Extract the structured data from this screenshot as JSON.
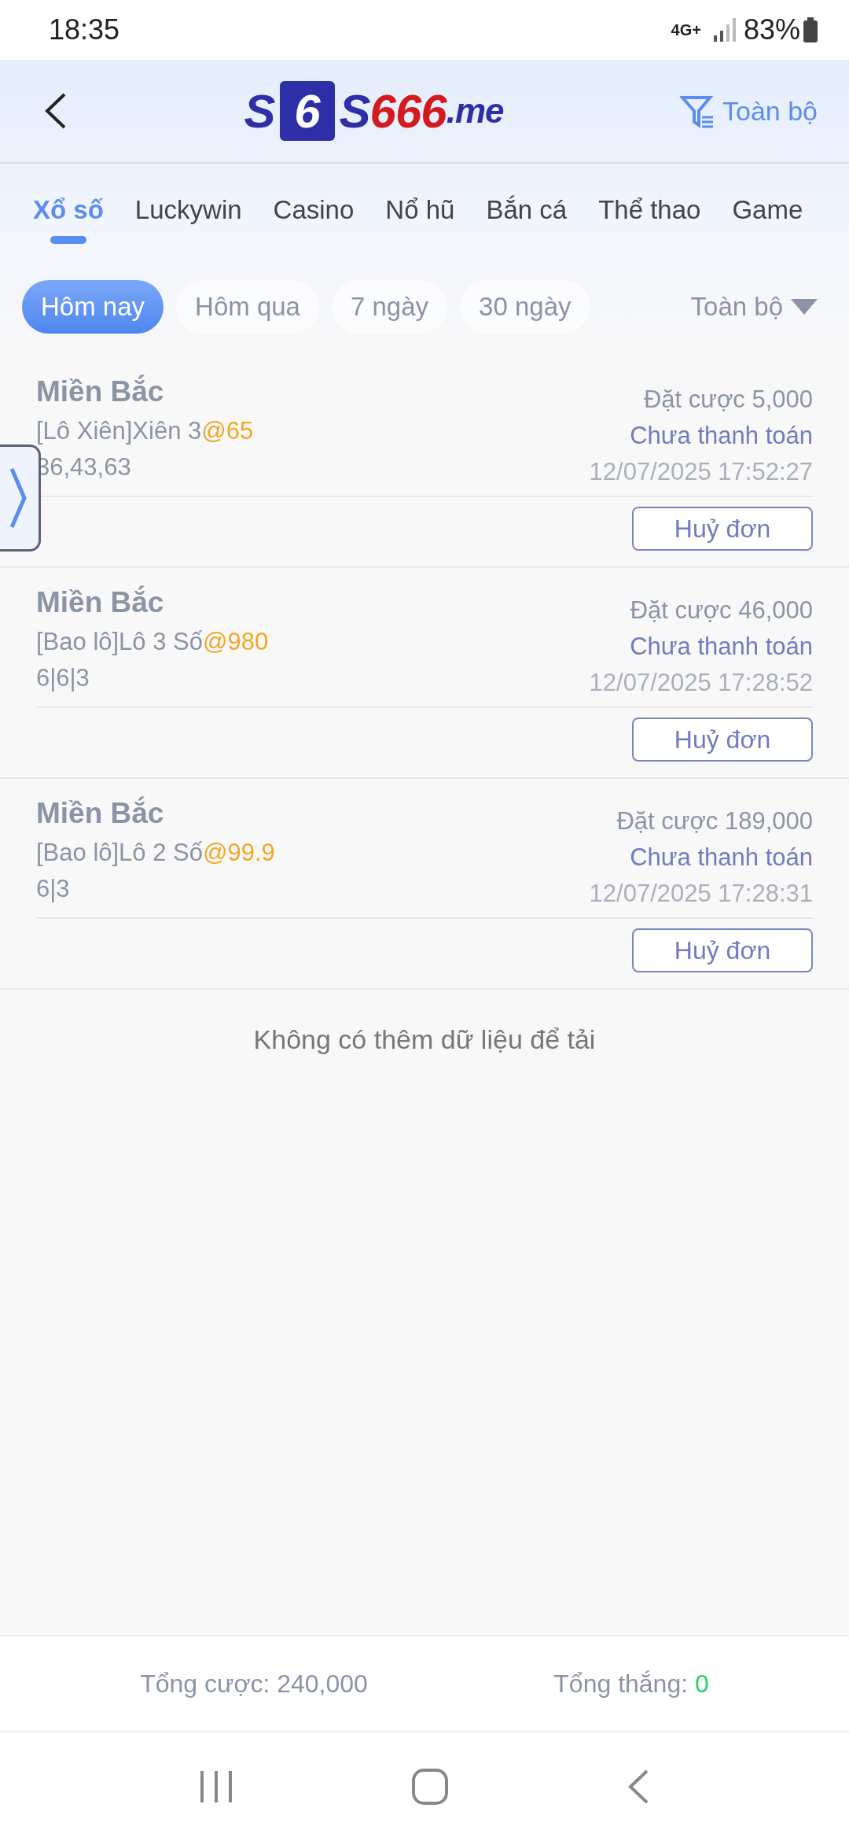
{
  "status_bar": {
    "time": "18:35",
    "network": "4G+",
    "battery": "83%"
  },
  "header": {
    "logo": {
      "left": "S",
      "dice": "6",
      "brand": "S",
      "digits": "666",
      "suffix": ".me"
    },
    "filter": "Toàn bộ"
  },
  "tabs": [
    {
      "label": "Xổ số",
      "selected": true
    },
    {
      "label": "Luckywin",
      "selected": false
    },
    {
      "label": "Casino",
      "selected": false
    },
    {
      "label": "Nổ hũ",
      "selected": false
    },
    {
      "label": "Bắn cá",
      "selected": false
    },
    {
      "label": "Thể thao",
      "selected": false
    },
    {
      "label": "Game",
      "selected": false
    }
  ],
  "periods": [
    {
      "label": "Hôm nay",
      "selected": true
    },
    {
      "label": "Hôm qua",
      "selected": false
    },
    {
      "label": "7 ngày",
      "selected": false
    },
    {
      "label": "30 ngày",
      "selected": false
    }
  ],
  "status_filter": "Toàn bộ",
  "bets": [
    {
      "region": "Miền Bắc",
      "bet_type": "[Lô Xiên]Xiên 3",
      "odds": "@65",
      "numbers": "36,43,63",
      "amount": "Đặt cược 5,000",
      "status": "Chưa thanh toán",
      "time": "12/07/2025 17:52:27",
      "action": "Huỷ đơn"
    },
    {
      "region": "Miền Bắc",
      "bet_type": "[Bao lô]Lô 3 Số",
      "odds": "@980",
      "numbers": "6|6|3",
      "amount": "Đặt cược 46,000",
      "status": "Chưa thanh toán",
      "time": "12/07/2025 17:28:52",
      "action": "Huỷ đơn"
    },
    {
      "region": "Miền Bắc",
      "bet_type": "[Bao lô]Lô 2 Số",
      "odds": "@99.9",
      "numbers": "6|3",
      "amount": "Đặt cược 189,000",
      "status": "Chưa thanh toán",
      "time": "12/07/2025 17:28:31",
      "action": "Huỷ đơn"
    }
  ],
  "end_message": "Không có thêm dữ liệu để tải",
  "totals": {
    "bet_label": "Tổng cược: 240,000",
    "win_label": "Tổng thắng: ",
    "win_value": "0"
  }
}
